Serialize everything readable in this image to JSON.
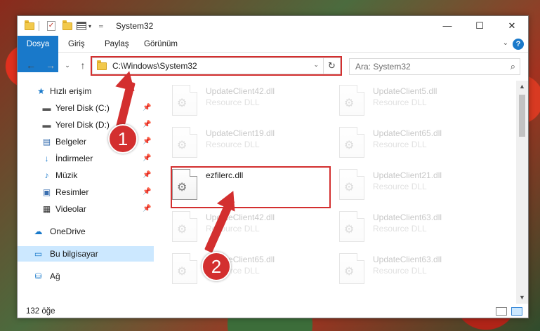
{
  "window": {
    "title": "System32"
  },
  "ribbon": {
    "tabs": [
      "Dosya",
      "Giriş",
      "Paylaş",
      "Görünüm"
    ]
  },
  "address": {
    "path": "C:\\Windows\\System32"
  },
  "search": {
    "placeholder": "Ara: System32"
  },
  "sidebar": {
    "items": [
      {
        "label": "Hızlı erişim",
        "icon": "star-icon"
      },
      {
        "label": "Yerel Disk (C:)",
        "icon": "drive-icon",
        "pinned": true
      },
      {
        "label": "Yerel Disk (D:)",
        "icon": "drive-icon",
        "pinned": true
      },
      {
        "label": "Belgeler",
        "icon": "documents-icon",
        "pinned": true
      },
      {
        "label": "İndirmeler",
        "icon": "download-icon",
        "pinned": true
      },
      {
        "label": "Müzik",
        "icon": "music-icon",
        "pinned": true
      },
      {
        "label": "Resimler",
        "icon": "pictures-icon",
        "pinned": true
      },
      {
        "label": "Videolar",
        "icon": "videos-icon",
        "pinned": true
      },
      {
        "label": "OneDrive",
        "icon": "cloud-icon"
      },
      {
        "label": "Bu bilgisayar",
        "icon": "computer-icon",
        "selected": true
      },
      {
        "label": "Ağ",
        "icon": "network-icon"
      }
    ]
  },
  "files": [
    {
      "name": "UpdateClient42.dll",
      "type": "Resource DLL"
    },
    {
      "name": "UpdateClient5.dll",
      "type": "Resource DLL"
    },
    {
      "name": "UpdateClient19.dll",
      "type": "Resource DLL"
    },
    {
      "name": "UpdateClient65.dll",
      "type": "Resource DLL"
    },
    {
      "name": "ezfilerc.dll",
      "type": ""
    },
    {
      "name": "UpdateClient21.dll",
      "type": "Resource DLL"
    },
    {
      "name": "UpdateClient42.dll",
      "type": "Resource DLL"
    },
    {
      "name": "UpdateClient63.dll",
      "type": "Resource DLL"
    },
    {
      "name": "UpdateClient65.dll",
      "type": "Resource DLL"
    },
    {
      "name": "UpdateClient63.dll",
      "type": "Resource DLL"
    }
  ],
  "status": {
    "count": "132 öğe"
  },
  "annotations": {
    "step1": "1",
    "step2": "2"
  },
  "colors": {
    "accent": "#1979ca",
    "highlight": "#d32f2f",
    "selection": "#cce8ff"
  }
}
